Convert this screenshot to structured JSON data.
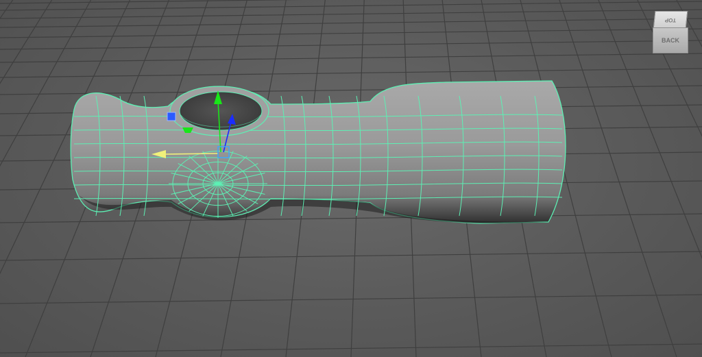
{
  "viewport": {
    "background_color": "#5d5d5d",
    "grid_color": "#3f3f3f",
    "wireframe_color": "#5df0b4"
  },
  "viewcube": {
    "top_label": "TOP",
    "front_label": "BACK"
  },
  "manipulator": {
    "y_axis_color": "#19e619",
    "z_axis_color": "#1a2cff",
    "x_axis_color": "#f0f07a"
  }
}
